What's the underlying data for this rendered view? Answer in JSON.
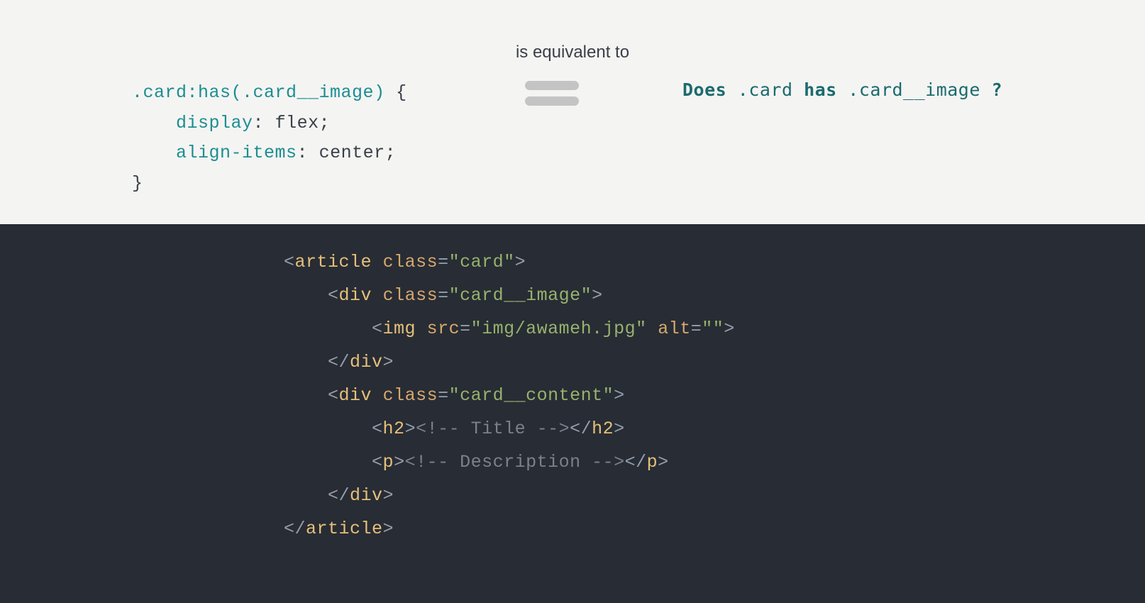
{
  "top": {
    "equiv_label": "is equivalent to",
    "css_selector": {
      "class": ".card",
      "pseudo": ":has(",
      "arg": ".card__image",
      "closeparen": ")",
      "brace_open": " {"
    },
    "css_decl1": {
      "indent": "    ",
      "prop": "display",
      "colon": ": ",
      "val": "flex;"
    },
    "css_decl2": {
      "indent": "    ",
      "prop": "align-items",
      "colon": ": ",
      "val": "center;"
    },
    "brace_close": "}",
    "question": {
      "word1": "Does ",
      "sel1": ".card",
      "word2": " has ",
      "sel2": ".card__image",
      "qmark": " ?"
    }
  },
  "html": {
    "l1": {
      "b1": "<",
      "tag": "article",
      "sp": " ",
      "attr": "class",
      "eq": "=",
      "q1": "\"",
      "val": "card",
      "q2": "\"",
      "b2": ">"
    },
    "l2": {
      "pad": "    ",
      "b1": "<",
      "tag": "div",
      "sp": " ",
      "attr": "class",
      "eq": "=",
      "q1": "\"",
      "val": "card__image",
      "q2": "\"",
      "b2": ">"
    },
    "l3": {
      "pad": "        ",
      "b1": "<",
      "tag": "img",
      "sp": " ",
      "attr1": "src",
      "eq1": "=",
      "q1": "\"",
      "val1": "img/awameh.jpg",
      "q2": "\"",
      "sp2": " ",
      "attr2": "alt",
      "eq2": "=",
      "q3": "\"",
      "q4": "\"",
      "b2": ">"
    },
    "l4": {
      "pad": "    ",
      "b1": "</",
      "tag": "div",
      "b2": ">"
    },
    "l5": {
      "pad": "    ",
      "b1": "<",
      "tag": "div",
      "sp": " ",
      "attr": "class",
      "eq": "=",
      "q1": "\"",
      "val": "card__content",
      "q2": "\"",
      "b2": ">"
    },
    "l6": {
      "pad": "        ",
      "b1": "<",
      "tag": "h2",
      "b2": ">",
      "comment": "<!-- Title -->",
      "b3": "</",
      "tag2": "h2",
      "b4": ">"
    },
    "l7": {
      "pad": "        ",
      "b1": "<",
      "tag": "p",
      "b2": ">",
      "comment": "<!-- Description -->",
      "b3": "</",
      "tag2": "p",
      "b4": ">"
    },
    "l8": {
      "pad": "    ",
      "b1": "</",
      "tag": "div",
      "b2": ">"
    },
    "l9": {
      "b1": "</",
      "tag": "article",
      "b2": ">"
    }
  }
}
